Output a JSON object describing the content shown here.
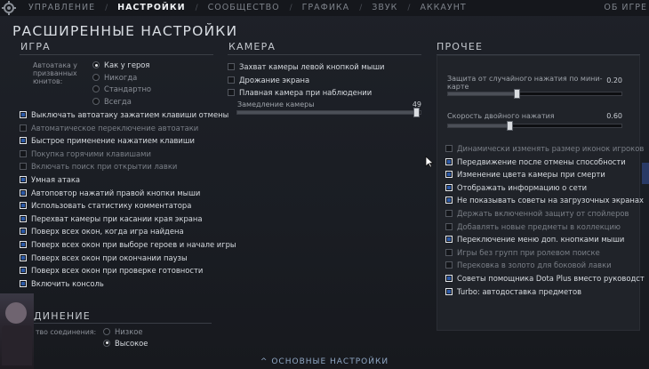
{
  "nav": {
    "items": [
      "УПРАВЛЕНИЕ",
      "НАСТРОЙКИ",
      "СООБЩЕСТВО",
      "ГРАФИКА",
      "ЗВУК",
      "АККАУНТ"
    ],
    "active": "НАСТРОЙКИ",
    "right": "ОБ ИГРЕ"
  },
  "page_title": "РАСШИРЕННЫЕ НАСТРОЙКИ",
  "game": {
    "title": "ИГРА",
    "autoattack_label_1": "Автоатака у",
    "autoattack_label_2": "призванных",
    "autoattack_label_3": "юнитов:",
    "radios": [
      {
        "label": "Как у героя",
        "selected": true
      },
      {
        "label": "Никогда",
        "selected": false
      },
      {
        "label": "Стандартно",
        "selected": false
      },
      {
        "label": "Всегда",
        "selected": false
      }
    ],
    "options": [
      {
        "label": "Выключать автоатаку зажатием клавиши отмены",
        "checked": true,
        "dim": false
      },
      {
        "label": "Автоматическое переключение автоатаки",
        "checked": false,
        "dim": true
      },
      {
        "label": "Быстрое применение нажатием клавиши",
        "checked": true,
        "dim": false
      },
      {
        "label": "Покупка горячими клавишами",
        "checked": false,
        "dim": true
      },
      {
        "label": "Включать поиск при открытии лавки",
        "checked": false,
        "dim": true
      },
      {
        "label": "Умная атака",
        "checked": true,
        "dim": false
      },
      {
        "label": "Автоповтор нажатий правой кнопки мыши",
        "checked": true,
        "dim": false
      },
      {
        "label": "Использовать статистику комментатора",
        "checked": true,
        "dim": false
      },
      {
        "label": "Перехват камеры при касании края экрана",
        "checked": true,
        "dim": false
      },
      {
        "label": "Поверх всех окон, когда игра найдена",
        "checked": true,
        "dim": false
      },
      {
        "label": "Поверх всех окон при выборе героев и начале игры",
        "checked": true,
        "dim": false
      },
      {
        "label": "Поверх всех окон при окончании паузы",
        "checked": true,
        "dim": false
      },
      {
        "label": "Поверх всех окон при проверке готовности",
        "checked": true,
        "dim": false
      },
      {
        "label": "Включить консоль",
        "checked": true,
        "dim": false
      }
    ]
  },
  "connection": {
    "title": "ДИНЕНИЕ",
    "quality_label": "тво соединения:",
    "radios": [
      {
        "label": "Низкое",
        "selected": false
      },
      {
        "label": "Высокое",
        "selected": true
      }
    ]
  },
  "camera": {
    "title": "КАМЕРА",
    "options": [
      {
        "label": "Захват камеры левой кнопкой мыши",
        "checked": false
      },
      {
        "label": "Дрожание экрана",
        "checked": false
      },
      {
        "label": "Плавная камера при наблюдении",
        "checked": false
      }
    ],
    "slider": {
      "label": "Замедление камеры",
      "value": "49",
      "fraction": 0.98
    }
  },
  "other": {
    "title": "ПРОЧЕЕ",
    "sliders": [
      {
        "label_1": "Защита от случайного нажатия по мини-",
        "label_2": "карте",
        "value": "0.20",
        "fraction": 0.4
      },
      {
        "label_1": "Скорость двойного нажатия",
        "label_2": "",
        "value": "0.60",
        "fraction": 0.36
      }
    ],
    "options": [
      {
        "label": "Динамически изменять размер иконок игроков",
        "checked": false,
        "dim": true
      },
      {
        "label": "Передвижение после отмены способности",
        "checked": true,
        "dim": false
      },
      {
        "label": "Изменение цвета камеры при смерти",
        "checked": true,
        "dim": false
      },
      {
        "label": "Отображать информацию о сети",
        "checked": true,
        "dim": false
      },
      {
        "label": "Не показывать советы на загрузочных экранах",
        "checked": true,
        "dim": false
      },
      {
        "label": "Держать включенной защиту от спойлеров",
        "checked": false,
        "dim": true
      },
      {
        "label": "Добавлять новые предметы в коллекцию",
        "checked": false,
        "dim": true
      },
      {
        "label": "Переключение меню доп. кнопками мыши",
        "checked": true,
        "dim": false
      },
      {
        "label": "Игры без групп при ролевом поиске",
        "checked": false,
        "dim": true
      },
      {
        "label": "Перековка в золото для боковой лавки",
        "checked": false,
        "dim": true
      },
      {
        "label": "Советы помощника Dota Plus вместо руководст",
        "checked": true,
        "dim": false
      },
      {
        "label": "Turbo: автодоставка предметов",
        "checked": true,
        "dim": false
      }
    ]
  },
  "bottom": {
    "label": "ОСНОВНЫЕ НАСТРОЙКИ",
    "arrow": "^"
  }
}
